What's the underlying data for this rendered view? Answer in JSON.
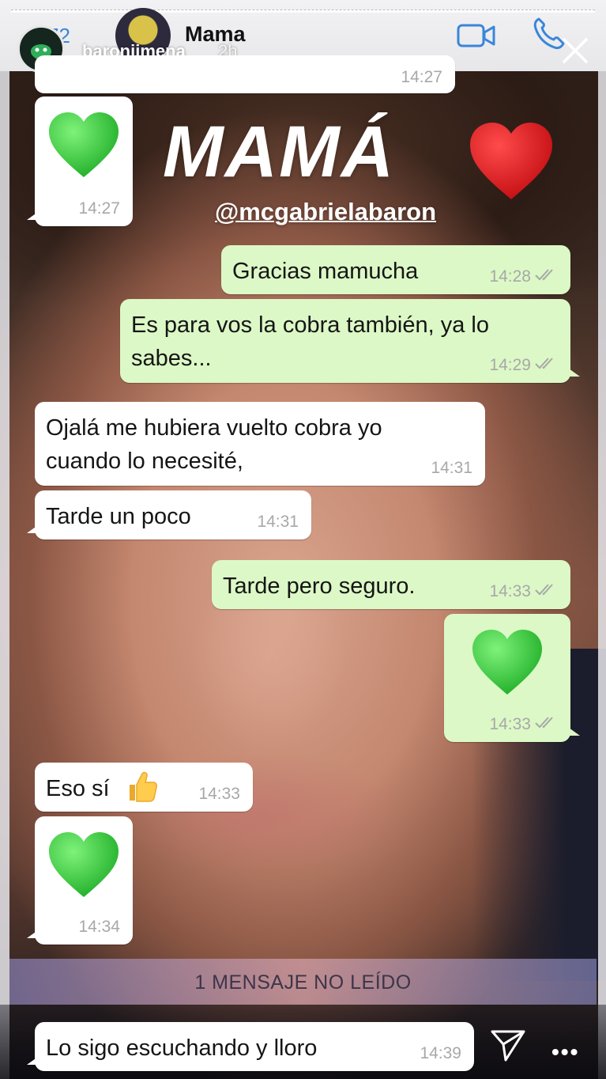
{
  "whatsapp_header": {
    "back_count": "72",
    "contact_name": "Mama"
  },
  "story": {
    "username": "baronjimena",
    "posted_ago": "2h"
  },
  "overlay": {
    "title": "MAMÁ",
    "mention": "@mcgabrielabaron"
  },
  "messages": [
    {
      "direction": "in",
      "text": "",
      "time": "14:27"
    },
    {
      "direction": "in",
      "text": "",
      "emoji": "green-heart",
      "time": "14:27"
    },
    {
      "direction": "out",
      "text": "Gracias mamucha",
      "time": "14:28"
    },
    {
      "direction": "out",
      "text": "Es para vos la cobra también, ya lo sabes...",
      "time": "14:29"
    },
    {
      "direction": "in",
      "text": "Ojalá me hubiera vuelto cobra yo cuando lo necesité,",
      "time": "14:31"
    },
    {
      "direction": "in",
      "text": "Tarde un poco",
      "time": "14:31"
    },
    {
      "direction": "out",
      "text": "Tarde pero seguro.",
      "time": "14:33"
    },
    {
      "direction": "out",
      "text": "",
      "emoji": "green-heart",
      "time": "14:33"
    },
    {
      "direction": "in",
      "text": "Eso sí",
      "emoji": "thumbs-up",
      "time": "14:33"
    },
    {
      "direction": "in",
      "text": "",
      "emoji": "green-heart",
      "time": "14:34"
    },
    {
      "direction": "in",
      "text": "Lo sigo escuchando y lloro",
      "time": "14:39"
    }
  ],
  "unread_banner": "1 MENSAJE NO LEÍDO",
  "colors": {
    "incoming_bubble": "#ffffff",
    "outgoing_bubble": "#dcf8c6",
    "whatsapp_blue": "#3a86d8",
    "green_heart": "#3fcf3f",
    "red_heart": "#e0161a"
  }
}
